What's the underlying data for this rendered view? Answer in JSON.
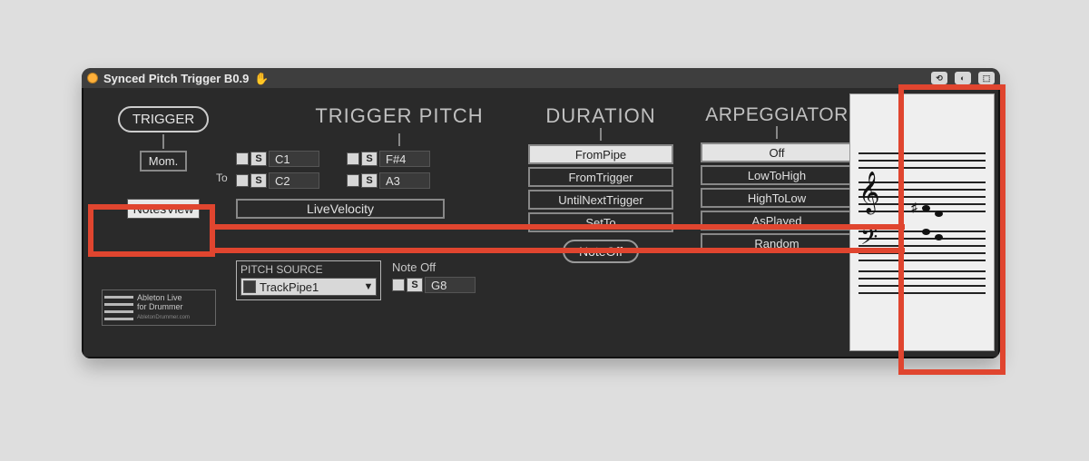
{
  "titlebar": {
    "title": "Synced Pitch Trigger B0.9",
    "hand_icon": "✋"
  },
  "trigger": {
    "header": "TRIGGER",
    "mode_label": "Mom.",
    "notesview_label": "NotesView"
  },
  "logo": {
    "line1": "Ableton Live",
    "line2": "for Drummer",
    "sub": "AbletonDrummer.com"
  },
  "pitch": {
    "header": "TRIGGER PITCH",
    "to_label": "To",
    "notes_left": [
      "C1",
      "C2"
    ],
    "notes_right": [
      "F#4",
      "A3"
    ],
    "live_velocity": "LiveVelocity"
  },
  "pitch_source": {
    "label": "PITCH SOURCE",
    "value": "TrackPipe1"
  },
  "noteoff": {
    "label": "Note Off",
    "note": "G8",
    "pill": "NoteOff"
  },
  "duration": {
    "header": "DURATION",
    "options": [
      "FromPipe",
      "FromTrigger",
      "UntilNextTrigger",
      "SetTo"
    ],
    "selected_index": 0
  },
  "arp": {
    "header": "ARPEGGIATOR",
    "options": [
      "Off",
      "LowToHigh",
      "HighToLow",
      "AsPlayed",
      "Random"
    ],
    "selected_index": 0
  }
}
